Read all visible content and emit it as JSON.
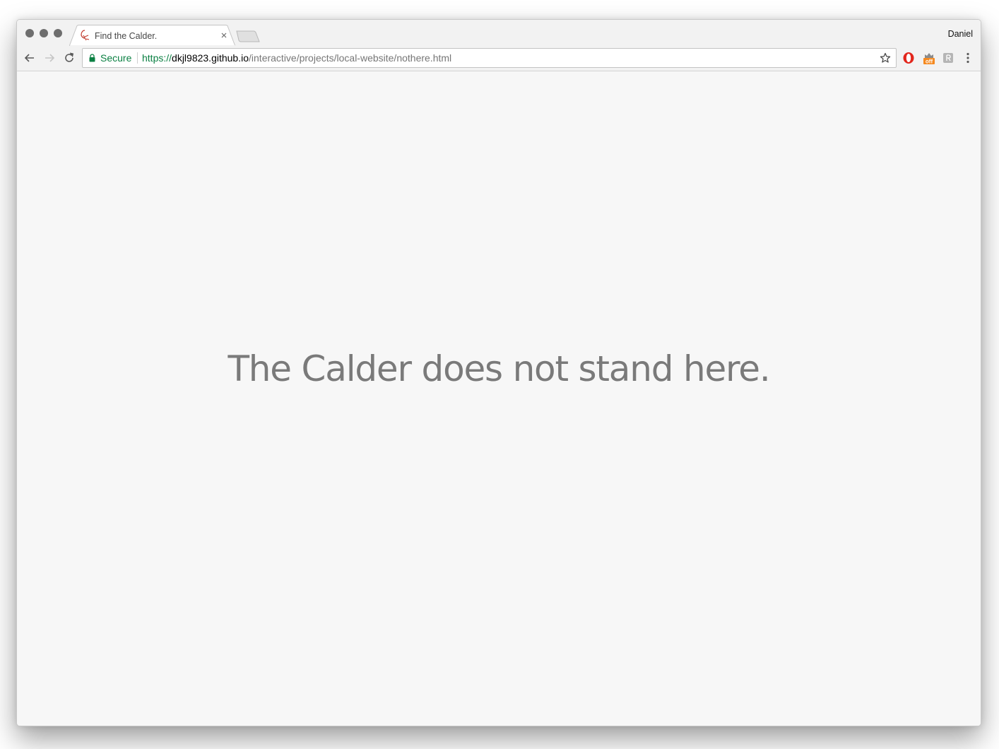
{
  "browser": {
    "profile_name": "Daniel",
    "tab": {
      "title": "Find the Calder.",
      "favicon": "calder-mobile-icon"
    },
    "omnibox": {
      "security_label": "Secure",
      "url_scheme": "https://",
      "url_host": "dkjl9823.github.io",
      "url_path": "/interactive/projects/local-website/nothere.html",
      "secure_color": "#0b8043"
    },
    "extensions": [
      {
        "name": "opera-icon",
        "color": "#e2261c"
      },
      {
        "name": "honey-icon",
        "badge": "off",
        "color": "#f5891f"
      },
      {
        "name": "extension-icon",
        "color": "#b5b5b5"
      }
    ]
  },
  "page": {
    "message": "The Calder does not stand here.",
    "text_color": "#7a7a7a",
    "background": "#f7f7f7"
  }
}
